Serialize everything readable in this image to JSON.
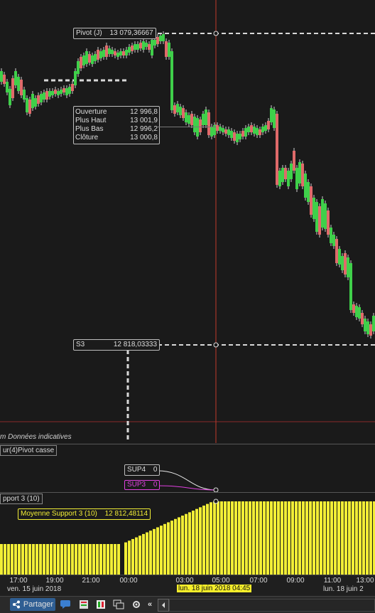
{
  "price_chart": {
    "pivot_label": "Pivot (J)",
    "pivot_value": "13 079,36667",
    "s3_label": "S3",
    "s3_value": "12 818,03333",
    "indicative_label": "m Données indicatives",
    "ohlc": [
      {
        "label": "Ouverture",
        "value": "12 996,8"
      },
      {
        "label": "Plus Haut",
        "value": "13 001,9"
      },
      {
        "label": "Plus Bas",
        "value": "12 996,2"
      },
      {
        "label": "Clôture",
        "value": "13 000,8"
      }
    ],
    "colors": {
      "up": "#3fd04a",
      "down": "#e06a6a",
      "crosshair": "#c0392b"
    }
  },
  "indicator1": {
    "title": "ur(4)Pivot casse",
    "sup4_label": "SUP4",
    "sup4_value": "0",
    "sup3_label": "SUP3",
    "sup3_value": "0",
    "sup3_color": "#e040e0"
  },
  "indicator2": {
    "title": "pport 3 (10)",
    "avg_label": "Moyenne Support 3 (10)",
    "avg_value": "12 812,48114",
    "bar_color": "#f2ee36"
  },
  "time_axis": {
    "ticks": [
      "17:00",
      "19:00",
      "21:00",
      "00:00",
      "03:00",
      "05:00",
      "07:00",
      "09:00",
      "11:00",
      "13:00"
    ],
    "left_date": "ven. 15 juin 2018",
    "cursor_date": "lun. 18 juin 2018 04:45",
    "right_date": "lun. 18 juin 2"
  },
  "toolbar": {
    "share_label": "Partager",
    "icons": [
      "share-icon",
      "comment-icon",
      "orders-icon",
      "drawing-icon",
      "screens-icon",
      "settings-icon",
      "collapse-icon",
      "left-arrow-icon"
    ]
  }
}
